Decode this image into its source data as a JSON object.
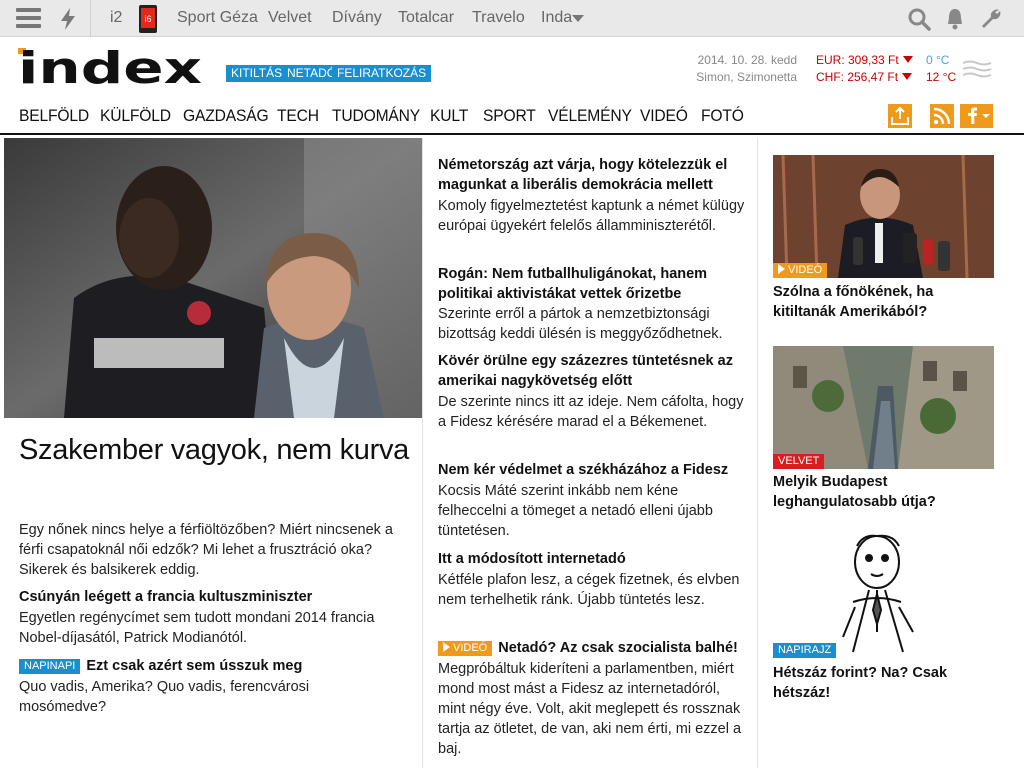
{
  "topbar": {
    "links": [
      "i2",
      "Sport Géza",
      "Velvet",
      "Dívány",
      "Totalcar",
      "Travelo",
      "Inda"
    ],
    "phone_label": "i6"
  },
  "header": {
    "logo_text": "index",
    "tags": [
      "KITILTÁS",
      "NETADÓ",
      "FELIRATKOZÁS"
    ],
    "date": "2014. 10. 28. kedd",
    "nameday": "Simon, Szimonetta",
    "eur": "EUR: 309,33 Ft",
    "chf": "CHF: 256,47 Ft",
    "temp_low": "0 °C",
    "temp_high": "12 °C"
  },
  "nav": [
    "BELFÖLD",
    "KÜLFÖLD",
    "GAZDASÁG",
    "TECH",
    "TUDOMÁNY",
    "KULT",
    "SPORT",
    "VÉLEMÉNY",
    "VIDEÓ",
    "FOTÓ"
  ],
  "main": {
    "hero_title": "Szakember vagyok, nem kurva",
    "hero_lead": "Egy nőnek nincs helye a férfiöltözőben? Miért nincsenek a férfi csapatoknál női edzők? Mi lehet a frusztráció oka? Sikerek és balsikerek eddig.",
    "sub1_title": "Csúnyán leégett a francia kultuszminiszter",
    "sub1_text": "Egyetlen regénycímet sem tudott mondani 2014 francia Nobel-díjasától, Patrick Modianótól.",
    "sub2_badge": "NAPINAPI",
    "sub2_title": "Ezt csak azért sem ússzuk meg",
    "sub2_text": "Quo vadis, Amerika? Quo vadis, ferencvárosi mosómedve?"
  },
  "middle": [
    {
      "title": "Németország azt várja, hogy kötelezzük el magunkat a liberális demokrácia mellett",
      "text": "Komoly figyelmeztetést kaptunk a német külügy európai ügyekért felelős államminiszterétől."
    },
    {
      "title": "Rogán: Nem futballhuligánokat, hanem politikai aktivistákat vettek őrizetbe",
      "text": "Szerinte erről a pártok a nemzetbiztonsági bizottság keddi ülésén is meggyőződhetnek."
    },
    {
      "title": "Kövér örülne egy százezres tüntetésnek az amerikai nagykövetség előtt",
      "text": "De szerinte nincs itt az ideje. Nem cáfolta, hogy a Fidesz kérésére marad el a Békemenet."
    },
    {
      "title": "Nem kér védelmet a székházához a Fidesz",
      "text": "Kocsis Máté szerint inkább nem kéne felheccelni a tömeget a netadó elleni újabb tüntetésen."
    },
    {
      "title": "Itt a módosított internetadó",
      "text": "Kétféle plafon lesz, a cégek fizetnek, és elvben nem terhelhetik ránk. Újabb tüntetés lesz."
    },
    {
      "badge": "VIDEÓ",
      "title": "Netadó? Az csak szocialista balhé!",
      "text": "Megpróbáltuk kideríteni a parlamentben, miért mond most mást a Fidesz az internetadóról, mint négy éve. Volt, akit meglepett és rossznak tartja az ötletet, de van, aki nem érti, mi ezzel a baj."
    }
  ],
  "side": [
    {
      "badge": "VIDEÓ",
      "title": "Szólna a főnökének, ha kitiltanák Amerikából?"
    },
    {
      "badge": "VELVET",
      "title": "Melyik Budapest leghangulatosabb útja?"
    },
    {
      "badge": "NAPIRAJZ",
      "title": "Hétszáz forint? Na? Csak hétszáz!"
    }
  ]
}
